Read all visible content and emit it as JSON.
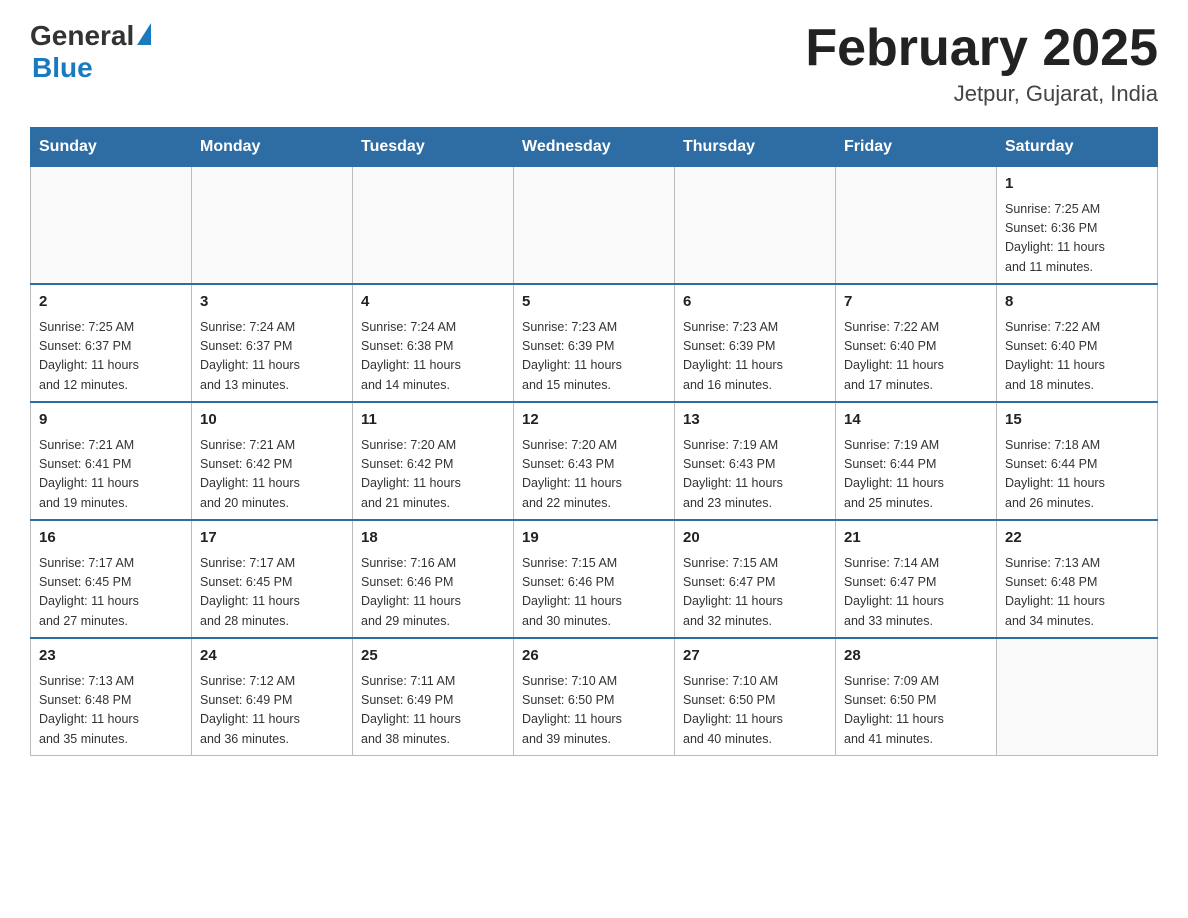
{
  "header": {
    "logo_general": "General",
    "logo_blue": "Blue",
    "title": "February 2025",
    "subtitle": "Jetpur, Gujarat, India"
  },
  "days_of_week": [
    "Sunday",
    "Monday",
    "Tuesday",
    "Wednesday",
    "Thursday",
    "Friday",
    "Saturday"
  ],
  "weeks": [
    {
      "days": [
        {
          "number": "",
          "info": ""
        },
        {
          "number": "",
          "info": ""
        },
        {
          "number": "",
          "info": ""
        },
        {
          "number": "",
          "info": ""
        },
        {
          "number": "",
          "info": ""
        },
        {
          "number": "",
          "info": ""
        },
        {
          "number": "1",
          "info": "Sunrise: 7:25 AM\nSunset: 6:36 PM\nDaylight: 11 hours\nand 11 minutes."
        }
      ]
    },
    {
      "days": [
        {
          "number": "2",
          "info": "Sunrise: 7:25 AM\nSunset: 6:37 PM\nDaylight: 11 hours\nand 12 minutes."
        },
        {
          "number": "3",
          "info": "Sunrise: 7:24 AM\nSunset: 6:37 PM\nDaylight: 11 hours\nand 13 minutes."
        },
        {
          "number": "4",
          "info": "Sunrise: 7:24 AM\nSunset: 6:38 PM\nDaylight: 11 hours\nand 14 minutes."
        },
        {
          "number": "5",
          "info": "Sunrise: 7:23 AM\nSunset: 6:39 PM\nDaylight: 11 hours\nand 15 minutes."
        },
        {
          "number": "6",
          "info": "Sunrise: 7:23 AM\nSunset: 6:39 PM\nDaylight: 11 hours\nand 16 minutes."
        },
        {
          "number": "7",
          "info": "Sunrise: 7:22 AM\nSunset: 6:40 PM\nDaylight: 11 hours\nand 17 minutes."
        },
        {
          "number": "8",
          "info": "Sunrise: 7:22 AM\nSunset: 6:40 PM\nDaylight: 11 hours\nand 18 minutes."
        }
      ]
    },
    {
      "days": [
        {
          "number": "9",
          "info": "Sunrise: 7:21 AM\nSunset: 6:41 PM\nDaylight: 11 hours\nand 19 minutes."
        },
        {
          "number": "10",
          "info": "Sunrise: 7:21 AM\nSunset: 6:42 PM\nDaylight: 11 hours\nand 20 minutes."
        },
        {
          "number": "11",
          "info": "Sunrise: 7:20 AM\nSunset: 6:42 PM\nDaylight: 11 hours\nand 21 minutes."
        },
        {
          "number": "12",
          "info": "Sunrise: 7:20 AM\nSunset: 6:43 PM\nDaylight: 11 hours\nand 22 minutes."
        },
        {
          "number": "13",
          "info": "Sunrise: 7:19 AM\nSunset: 6:43 PM\nDaylight: 11 hours\nand 23 minutes."
        },
        {
          "number": "14",
          "info": "Sunrise: 7:19 AM\nSunset: 6:44 PM\nDaylight: 11 hours\nand 25 minutes."
        },
        {
          "number": "15",
          "info": "Sunrise: 7:18 AM\nSunset: 6:44 PM\nDaylight: 11 hours\nand 26 minutes."
        }
      ]
    },
    {
      "days": [
        {
          "number": "16",
          "info": "Sunrise: 7:17 AM\nSunset: 6:45 PM\nDaylight: 11 hours\nand 27 minutes."
        },
        {
          "number": "17",
          "info": "Sunrise: 7:17 AM\nSunset: 6:45 PM\nDaylight: 11 hours\nand 28 minutes."
        },
        {
          "number": "18",
          "info": "Sunrise: 7:16 AM\nSunset: 6:46 PM\nDaylight: 11 hours\nand 29 minutes."
        },
        {
          "number": "19",
          "info": "Sunrise: 7:15 AM\nSunset: 6:46 PM\nDaylight: 11 hours\nand 30 minutes."
        },
        {
          "number": "20",
          "info": "Sunrise: 7:15 AM\nSunset: 6:47 PM\nDaylight: 11 hours\nand 32 minutes."
        },
        {
          "number": "21",
          "info": "Sunrise: 7:14 AM\nSunset: 6:47 PM\nDaylight: 11 hours\nand 33 minutes."
        },
        {
          "number": "22",
          "info": "Sunrise: 7:13 AM\nSunset: 6:48 PM\nDaylight: 11 hours\nand 34 minutes."
        }
      ]
    },
    {
      "days": [
        {
          "number": "23",
          "info": "Sunrise: 7:13 AM\nSunset: 6:48 PM\nDaylight: 11 hours\nand 35 minutes."
        },
        {
          "number": "24",
          "info": "Sunrise: 7:12 AM\nSunset: 6:49 PM\nDaylight: 11 hours\nand 36 minutes."
        },
        {
          "number": "25",
          "info": "Sunrise: 7:11 AM\nSunset: 6:49 PM\nDaylight: 11 hours\nand 38 minutes."
        },
        {
          "number": "26",
          "info": "Sunrise: 7:10 AM\nSunset: 6:50 PM\nDaylight: 11 hours\nand 39 minutes."
        },
        {
          "number": "27",
          "info": "Sunrise: 7:10 AM\nSunset: 6:50 PM\nDaylight: 11 hours\nand 40 minutes."
        },
        {
          "number": "28",
          "info": "Sunrise: 7:09 AM\nSunset: 6:50 PM\nDaylight: 11 hours\nand 41 minutes."
        },
        {
          "number": "",
          "info": ""
        }
      ]
    }
  ]
}
